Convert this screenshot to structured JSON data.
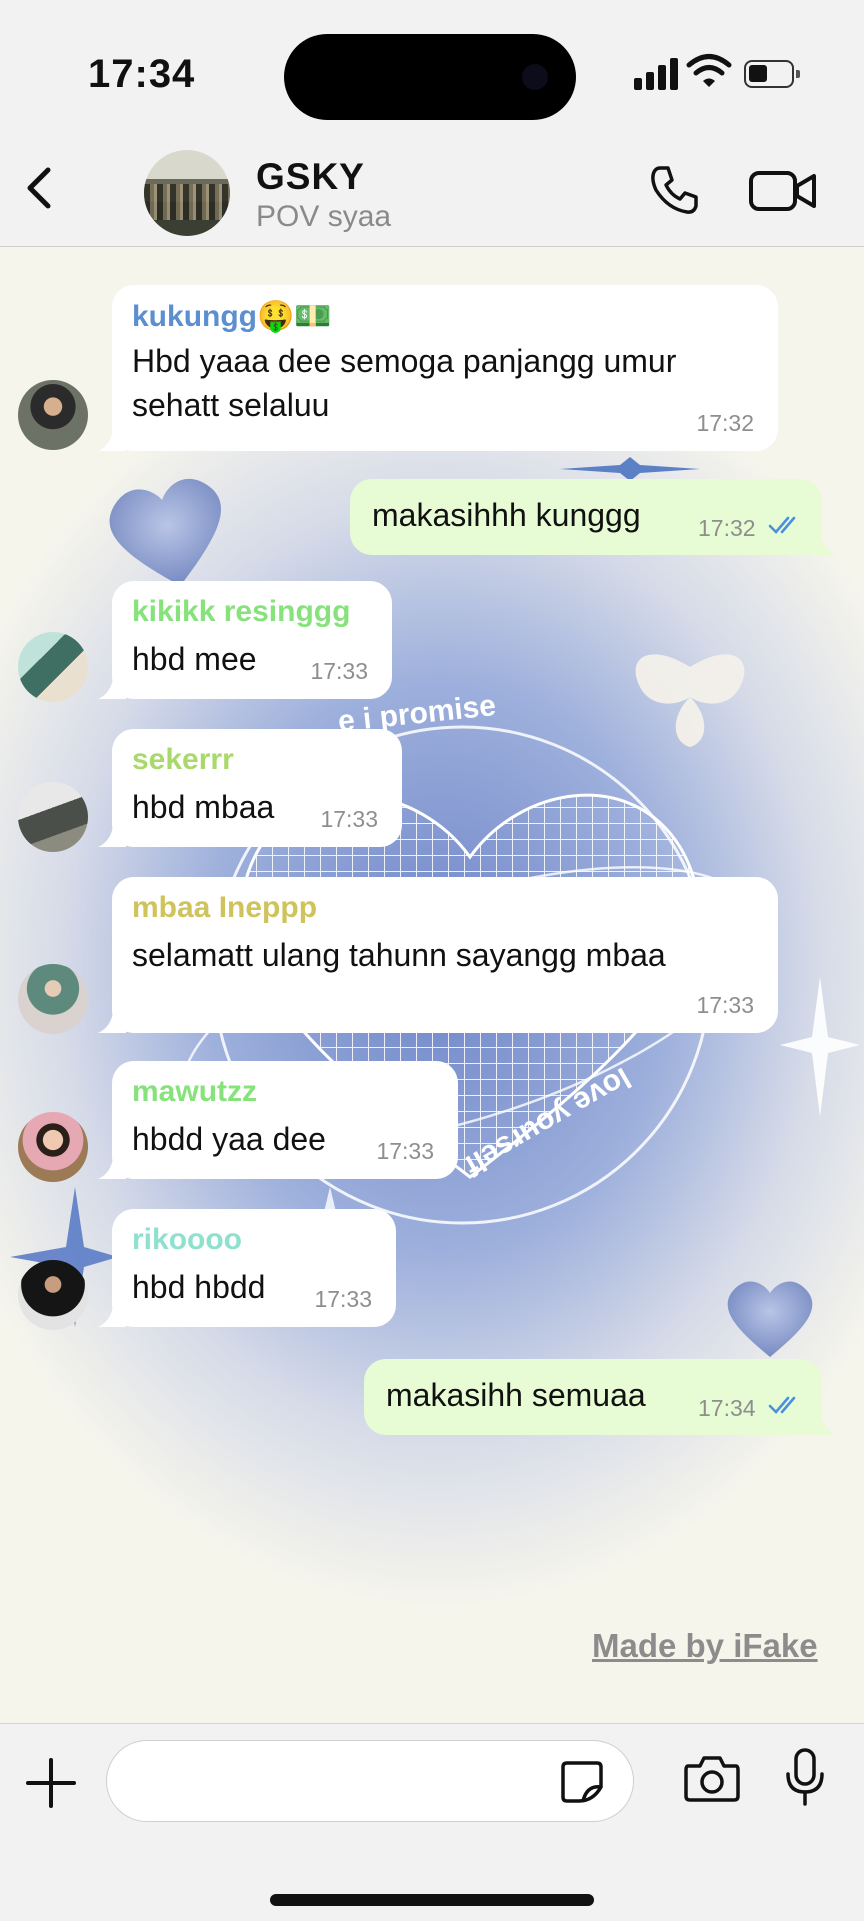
{
  "status_bar": {
    "time": "17:34"
  },
  "header": {
    "title": "GSKY",
    "subtitle": "POV syaa",
    "back_icon": "chevron-left-icon",
    "call_icon": "phone-icon",
    "video_icon": "video-camera-icon"
  },
  "wallpaper_text": {
    "top": "e i promise",
    "bottom": "love yourself"
  },
  "messages": [
    {
      "sender": "kukungg🤑💵",
      "sender_color": "#5b8fd0",
      "lines": [
        "Hbd yaaa dee semoga panjangg umur",
        "sehatt selaluu"
      ],
      "time": "17:32",
      "outgoing": false
    },
    {
      "lines": [
        "makasihhh kunggg"
      ],
      "time": "17:32",
      "outgoing": true
    },
    {
      "sender": "kikikk resinggg",
      "sender_color": "#86e27a",
      "lines": [
        "hbd mee"
      ],
      "time": "17:33",
      "outgoing": false
    },
    {
      "sender": "sekerrr",
      "sender_color": "#a9d96b",
      "lines": [
        "hbd mbaa"
      ],
      "time": "17:33",
      "outgoing": false
    },
    {
      "sender": "mbaa Ineppp",
      "sender_color": "#cfc35c",
      "lines": [
        "selamatt ulang tahunn sayangg mbaa"
      ],
      "time": "17:33",
      "outgoing": false
    },
    {
      "sender": "mawutzz",
      "sender_color": "#86e27a",
      "lines": [
        "hbdd yaa dee"
      ],
      "time": "17:33",
      "outgoing": false
    },
    {
      "sender": "rikoooo",
      "sender_color": "#8fe0cf",
      "lines": [
        "hbd hbdd"
      ],
      "time": "17:33",
      "outgoing": false
    },
    {
      "lines": [
        "makasihh semuaa"
      ],
      "time": "17:34",
      "outgoing": true
    }
  ],
  "watermark": "Made by iFake",
  "input_bar": {
    "placeholder": "",
    "plus_icon": "plus-icon",
    "sticker_icon": "sticker-icon",
    "camera_icon": "camera-icon",
    "mic_icon": "microphone-icon"
  },
  "colors": {
    "outgoing_bubble": "#e7fbd5",
    "incoming_bubble": "#ffffff",
    "read_ticks": "#4a90e2"
  }
}
